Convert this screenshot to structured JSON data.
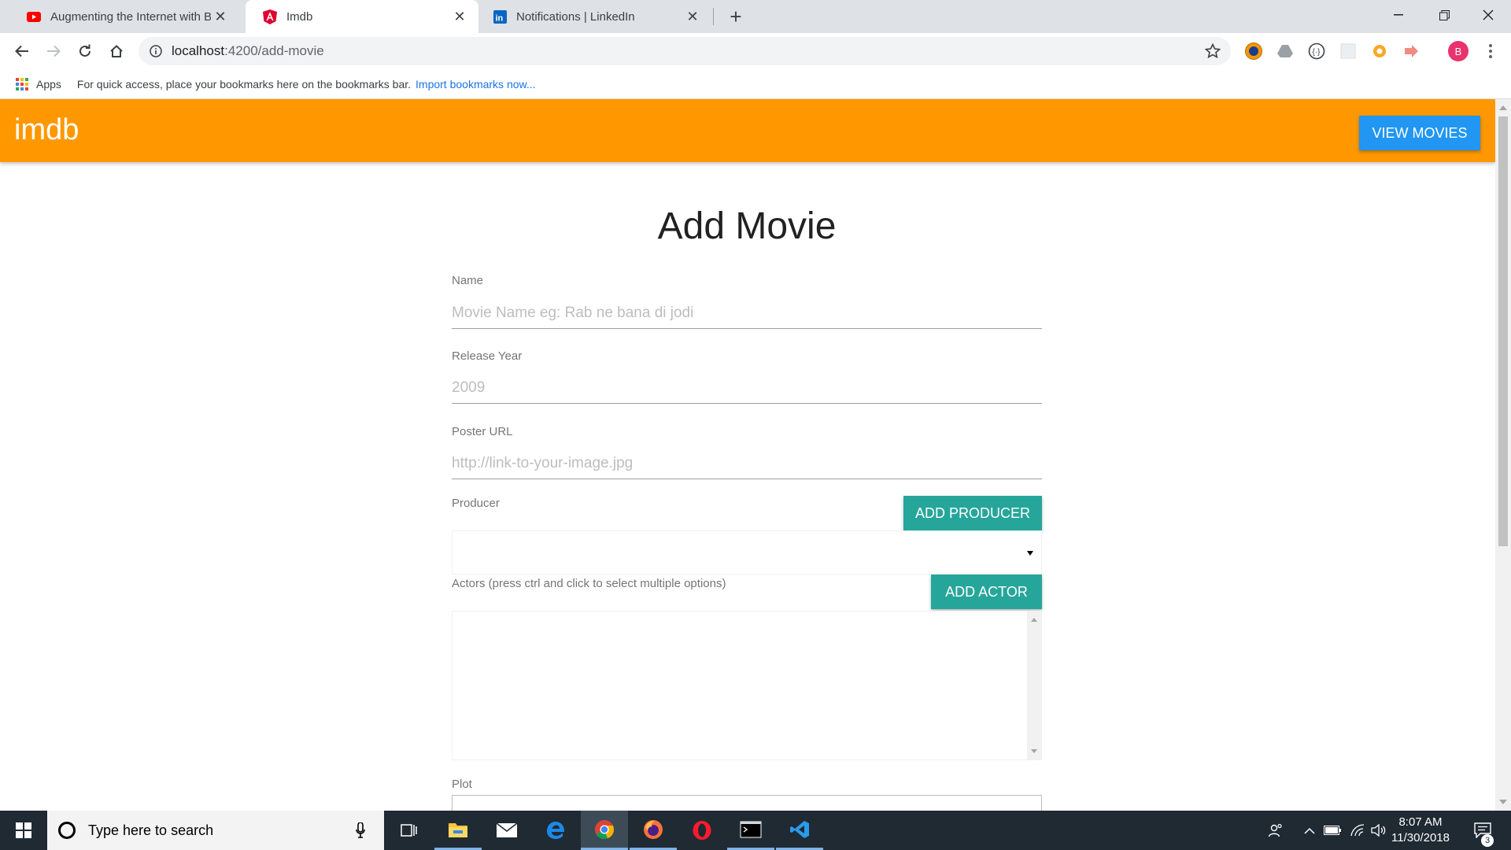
{
  "browser": {
    "tabs": [
      {
        "title": "Augmenting the Internet with Br",
        "favicon": "youtube-icon",
        "active": false
      },
      {
        "title": "Imdb",
        "favicon": "angular-icon",
        "active": true
      },
      {
        "title": "Notifications | LinkedIn",
        "favicon": "linkedin-icon",
        "active": false
      }
    ],
    "url_host": "localhost",
    "url_path": ":4200/add-movie",
    "bookmarks": {
      "apps_label": "Apps",
      "hint": "For quick access, place your bookmarks here on the bookmarks bar.",
      "import_link": "Import bookmarks now..."
    },
    "profile_initial": "B",
    "colors": {
      "tabstrip": "#dee1e6",
      "profile": "#e8336d",
      "import_link": "#1a73e8"
    }
  },
  "app": {
    "brand": "imdb",
    "view_movies_label": "VIEW MOVIES",
    "colors": {
      "appbar": "#ff9800",
      "primary_button": "#2196f3",
      "teal_button": "#26a69a"
    }
  },
  "form": {
    "title": "Add Movie",
    "name": {
      "label": "Name",
      "placeholder": "Movie Name eg: Rab ne bana di jodi"
    },
    "release_year": {
      "label": "Release Year",
      "placeholder": "2009"
    },
    "poster_url": {
      "label": "Poster URL",
      "placeholder": "http://link-to-your-image.jpg"
    },
    "producer": {
      "label": "Producer",
      "button": "ADD PRODUCER",
      "selected": ""
    },
    "actors": {
      "label": "Actors (press ctrl and click to select multiple options)",
      "button": "ADD ACTOR"
    },
    "plot": {
      "label": "Plot"
    }
  },
  "taskbar": {
    "search_placeholder": "Type here to search",
    "time": "8:07 AM",
    "date": "11/30/2018",
    "notification_count": "3",
    "apps": [
      "task-view-icon",
      "file-explorer-icon",
      "mail-icon",
      "edge-icon",
      "chrome-icon",
      "firefox-icon",
      "opera-icon",
      "terminal-icon",
      "vscode-icon"
    ]
  }
}
